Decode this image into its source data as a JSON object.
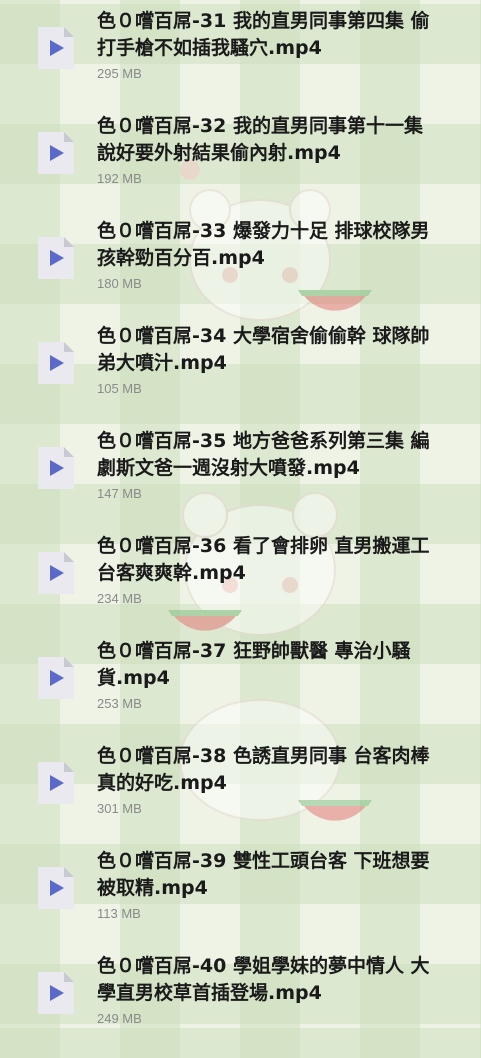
{
  "files": [
    {
      "title": "色０嚐百屌-31 我的直男同事第四集 偷\n打手槍不如插我騷穴.mp4",
      "size": "295 MB",
      "icon": "video-file-icon"
    },
    {
      "title": "色０嚐百屌-32 我的直男同事第十一集\n說好要外射結果偷內射.mp4",
      "size": "192 MB",
      "icon": "video-file-icon"
    },
    {
      "title": "色０嚐百屌-33 爆發力十足 排球校隊男\n孩幹勁百分百.mp4",
      "size": "180 MB",
      "icon": "video-file-icon"
    },
    {
      "title": "色０嚐百屌-34 大學宿舍偷偷幹 球隊帥\n弟大噴汁.mp4",
      "size": "105 MB",
      "icon": "video-file-icon"
    },
    {
      "title": "色０嚐百屌-35 地方爸爸系列第三集 編\n劇斯文爸一週沒射大噴發.mp4",
      "size": "147 MB",
      "icon": "video-file-icon"
    },
    {
      "title": "色０嚐百屌-36 看了會排卵 直男搬運工\n台客爽爽幹.mp4",
      "size": "234 MB",
      "icon": "video-file-icon"
    },
    {
      "title": "色０嚐百屌-37 狂野帥獸醫 專治小騷\n貨.mp4",
      "size": "253 MB",
      "icon": "video-file-icon"
    },
    {
      "title": "色０嚐百屌-38 色誘直男同事 台客肉棒\n真的好吃.mp4",
      "size": "301 MB",
      "icon": "video-file-icon"
    },
    {
      "title": "色０嚐百屌-39 雙性工頭台客 下班想要\n被取精.mp4",
      "size": "113 MB",
      "icon": "video-file-icon"
    },
    {
      "title": "色０嚐百屌-40 學姐學妹的夢中情人 大\n學直男校草首插登場.mp4",
      "size": "249 MB",
      "icon": "video-file-icon"
    }
  ],
  "colors": {
    "icon_body": "#e9e9ef",
    "icon_fold": "#c9c9d4",
    "play_triangle": "#5b6ac9",
    "title_text": "#1a1a1a",
    "size_text": "#8a8a8a"
  }
}
